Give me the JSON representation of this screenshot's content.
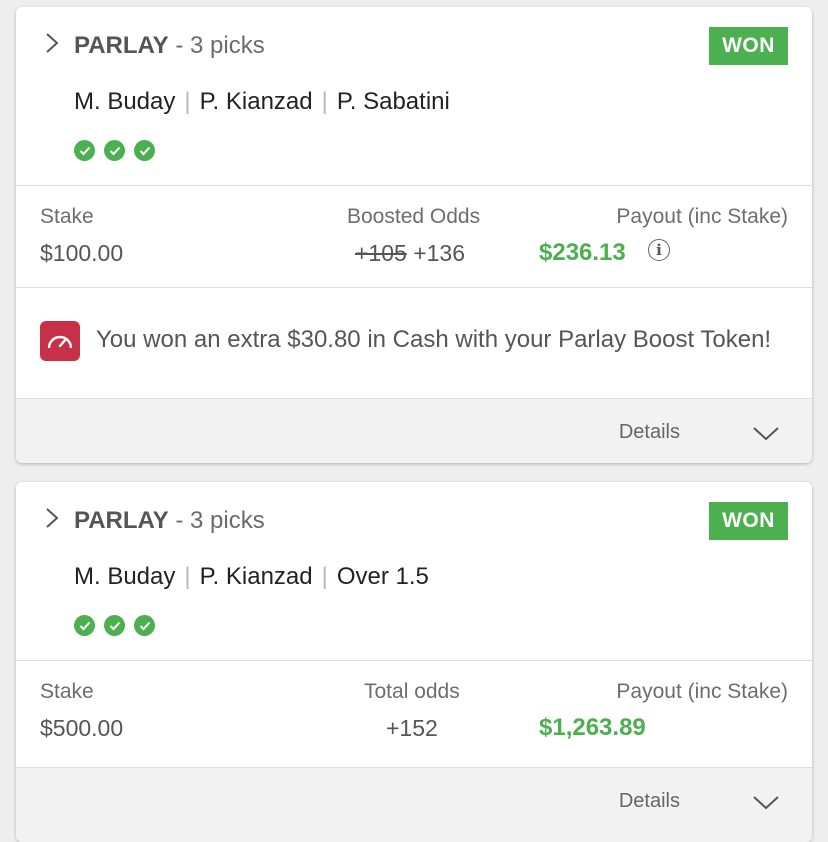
{
  "bets": [
    {
      "type_label": "PARLAY",
      "picks_label": " - 3 picks",
      "status": "WON",
      "legs": [
        "M. Buday",
        "P. Kianzad",
        "P. Sabatini"
      ],
      "legs_separator": "|",
      "legs_won": 3,
      "stake_label": "Stake",
      "stake_value": "$100.00",
      "odds_label": "Boosted Odds",
      "odds_original": "+105",
      "odds_value": "+136",
      "payout_label": "Payout (inc Stake)",
      "payout_value": "$236.13",
      "boost_message": "You won an extra $30.80 in Cash with your Parlay Boost Token!",
      "details_label": "Details"
    },
    {
      "type_label": "PARLAY",
      "picks_label": " - 3 picks",
      "status": "WON",
      "legs": [
        "M. Buday",
        "P. Kianzad",
        "Over 1.5"
      ],
      "legs_separator": "|",
      "legs_won": 3,
      "stake_label": "Stake",
      "stake_value": "$500.00",
      "odds_label": "Total odds",
      "odds_value": "+152",
      "payout_label": "Payout (inc Stake)",
      "payout_value": "$1,263.89",
      "details_label": "Details"
    }
  ],
  "colors": {
    "won_green": "#4caf50",
    "boost_red": "#c8304a"
  },
  "icons": {
    "expand": "chevron-right-icon",
    "leg_status": "check-circle-icon",
    "info": "info-icon",
    "boost": "speedometer-icon",
    "details": "chevron-down-icon"
  }
}
